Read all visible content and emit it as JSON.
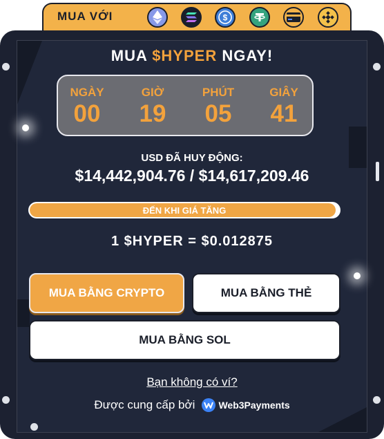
{
  "pay_tab": {
    "label": "MUA VỚI",
    "coins": [
      {
        "icon": "ethereum-icon",
        "color": "#8799e8"
      },
      {
        "icon": "solana-icon",
        "color": "#1b1f2a"
      },
      {
        "icon": "usdc-icon",
        "color": "#3f7fd8"
      },
      {
        "icon": "tether-icon",
        "color": "#35a37e"
      },
      {
        "icon": "card-icon",
        "color": "#f3b24a"
      },
      {
        "icon": "bnb-icon",
        "color": "#f3c14a"
      }
    ]
  },
  "widget": {
    "title_prefix": "MUA",
    "title_token": "$HYPER",
    "title_suffix": "NGAY!",
    "countdown": [
      {
        "label": "NGÀY",
        "value": "00"
      },
      {
        "label": "GIỜ",
        "value": "19"
      },
      {
        "label": "PHÚT",
        "value": "05"
      },
      {
        "label": "GIÂY",
        "value": "41"
      }
    ],
    "raised_label": "USD ĐÃ HUY ĐỘNG:",
    "raised_amount": "$14,442,904.76 / $14,617,209.46",
    "progress": {
      "text": "ĐẾN KHI GIÁ TĂNG",
      "fraction": 0.988
    },
    "price": "1 $HYPER = $0.012875",
    "buttons": {
      "crypto": "MUA BẰNG CRYPTO",
      "card": "MUA BẰNG THẺ",
      "sol": "MUA BẰNG SOL"
    },
    "no_wallet": "Bạn không có ví?",
    "powered_by": "Được cung cấp bởi",
    "provider": "Web3Payments",
    "accent_color": "#f3a23c"
  }
}
